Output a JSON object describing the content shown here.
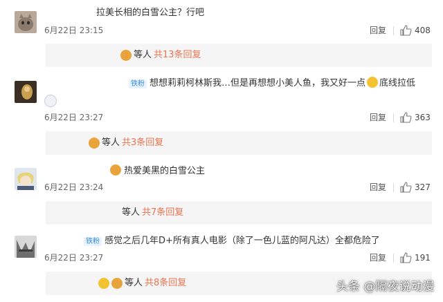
{
  "comments": [
    {
      "text": "拉美长相的白雪公主？行吧",
      "time": "6月22日 23:15",
      "reply_label": "回复",
      "likes": "408",
      "thread": {
        "who": "等人",
        "count": "共13条回复"
      }
    },
    {
      "badge": "铁粉",
      "text_a": "想想莉莉柯林斯我…但是再想想小美人鱼，我又好一点",
      "text_b": "底线拉低",
      "time": "6月22日 23:27",
      "reply_label": "回复",
      "likes": "363",
      "thread": {
        "who": "等人",
        "count": "共3条回复"
      }
    },
    {
      "text": "热爱美黑的白雪公主",
      "time": "6月22日 23:24",
      "reply_label": "回复",
      "likes": "327",
      "thread": {
        "who": "等人",
        "count": "共7条回复"
      }
    },
    {
      "badge": "铁粉",
      "text": "感觉之后几年D+所有真人电影（除了一色儿蓝的阿凡达）全都危险了",
      "time": "6月22日 23:27",
      "reply_label": "回复",
      "likes": "191",
      "thread": {
        "who": "等人",
        "count": "共8条回复"
      }
    }
  ],
  "watermark": "头条 @隔夜说动漫",
  "colors": {
    "accent": "#eb7350",
    "badge_bg": "#e8f3ff",
    "badge_text": "#3b8fd6",
    "sub_bg": "#f5f5f5"
  },
  "icons": [
    "thumb-up-icon",
    "avatar-icon",
    "emoji-icon"
  ]
}
